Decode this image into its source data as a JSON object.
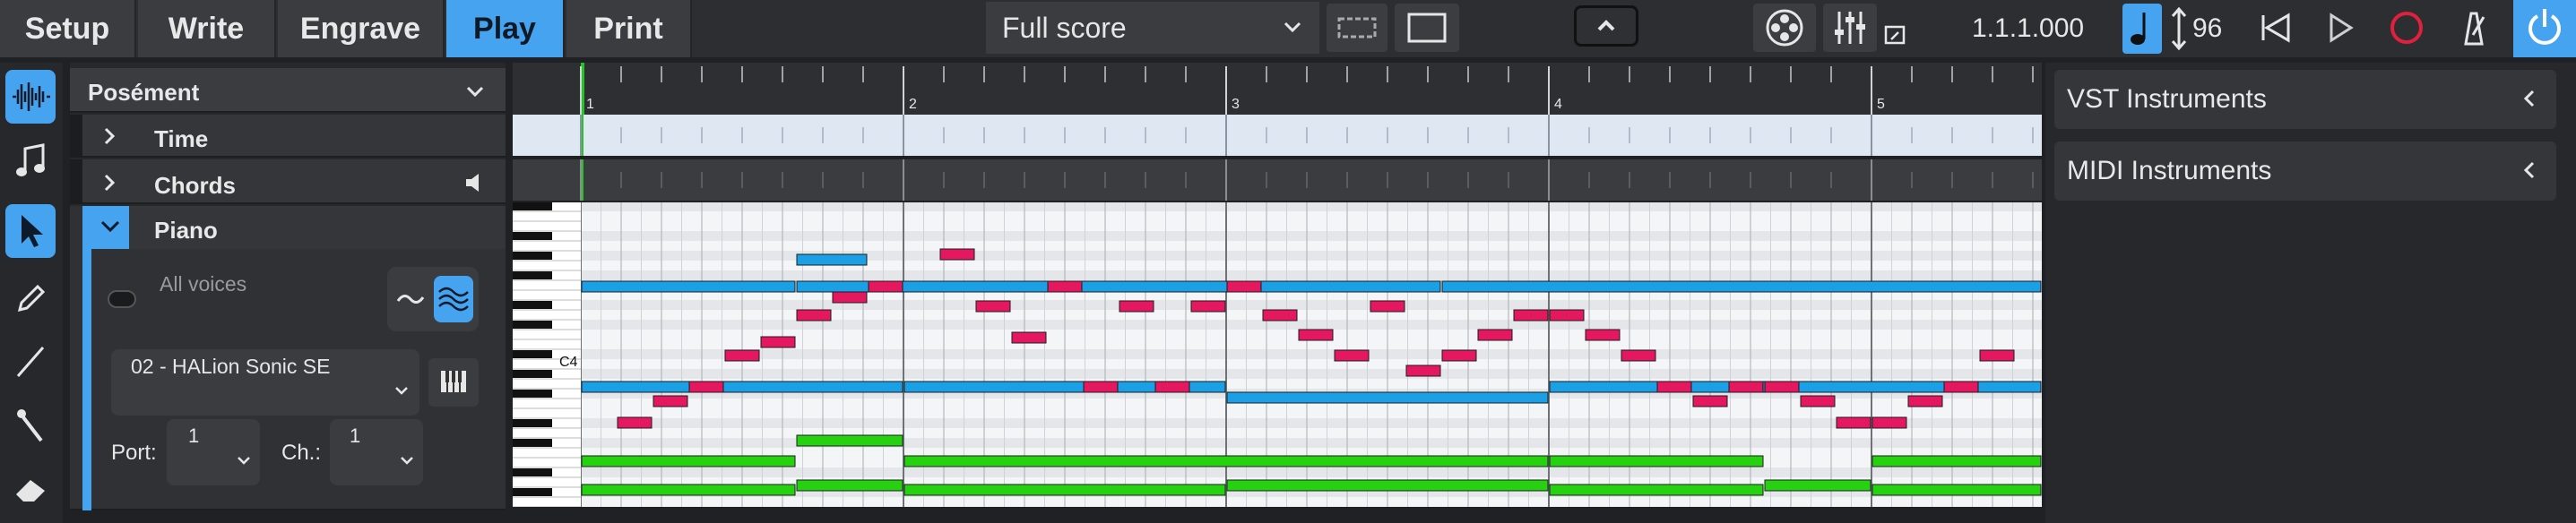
{
  "modes": [
    {
      "id": "setup",
      "label": "Setup",
      "active": false
    },
    {
      "id": "write",
      "label": "Write",
      "active": false
    },
    {
      "id": "engrave",
      "label": "Engrave",
      "active": false
    },
    {
      "id": "play",
      "label": "Play",
      "active": true
    },
    {
      "id": "print",
      "label": "Print",
      "active": false
    }
  ],
  "layout_selector": {
    "value": "Full score"
  },
  "transport": {
    "position": "1.1.1.000",
    "tempo": "96"
  },
  "project": {
    "flow_name": "Posément"
  },
  "tracks": {
    "time": {
      "label": "Time"
    },
    "chords": {
      "label": "Chords"
    },
    "piano": {
      "label": "Piano",
      "voices_label": "All voices",
      "instrument": "02 - HALion Sonic SE",
      "port_label": "Port:",
      "port_value": "1",
      "channel_label": "Ch.:",
      "channel_value": "1"
    }
  },
  "ruler": {
    "bars": [
      "1",
      "2",
      "3",
      "4",
      "5"
    ]
  },
  "keyboard": {
    "c4_label": "C4"
  },
  "right_panel": {
    "items": [
      {
        "label": "VST Instruments"
      },
      {
        "label": "MIDI Instruments"
      }
    ]
  },
  "colors": {
    "accent": "#46a3f0",
    "note_pink": "#e5185f",
    "note_blue": "#1ba0e6",
    "note_green": "#26d20f",
    "playhead": "#25c325"
  },
  "icons": [
    "waveform-icon",
    "music-note-icon",
    "pointer-icon",
    "pencil-icon",
    "line-icon",
    "pen-icon",
    "eraser-icon",
    "film-reel-icon",
    "mixer-icon",
    "quarter-note-icon",
    "rewind-icon",
    "play-icon",
    "record-icon",
    "metronome-icon",
    "power-icon"
  ]
}
